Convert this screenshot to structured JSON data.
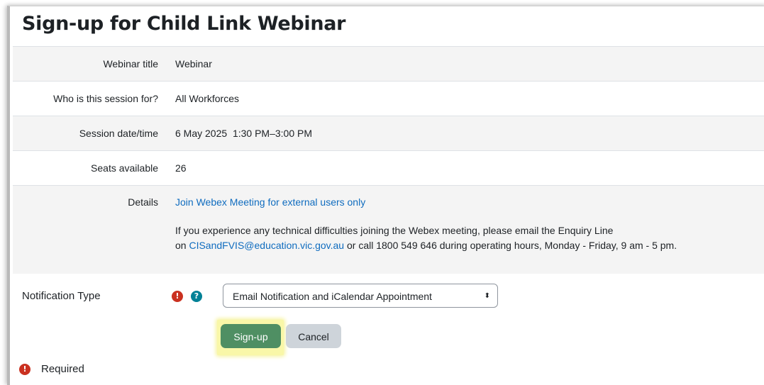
{
  "page": {
    "title": "Sign-up for Child Link Webinar"
  },
  "info_rows": [
    {
      "label": "Webinar title",
      "value": "Webinar"
    },
    {
      "label": "Who is this session for?",
      "value": "All Workforces"
    },
    {
      "label": "Session date/time",
      "value": "6 May 2025  1:30 PM–3:00 PM"
    },
    {
      "label": "Seats available",
      "value": "26"
    }
  ],
  "details": {
    "label": "Details",
    "link_text": "Join Webex Meeting for external users only",
    "text_line1": "If you experience any technical difficulties joining the Webex meeting, please email the Enquiry Line",
    "text_on": "on ",
    "email": "CISandFVIS@education.vic.gov.au",
    "text_rest": " or call 1800 549 646 during operating hours, Monday - Friday, 9 am - 5 pm."
  },
  "form": {
    "notification_label": "Notification Type",
    "required_icon": "exclamation-circle-icon",
    "help_icon": "question-circle-icon",
    "required_glyph": "!",
    "help_glyph": "?",
    "notification_selected": "Email Notification and iCalendar Appointment",
    "select_arrow": "⬍"
  },
  "actions": {
    "signup_label": "Sign-up",
    "cancel_label": "Cancel"
  },
  "footer": {
    "required_text": "Required"
  },
  "colors": {
    "link": "#0f6cbf",
    "required_badge": "#ca3120",
    "help_badge": "#008196",
    "primary_button": "#4f8f63",
    "highlight": "#f9f7a8"
  }
}
